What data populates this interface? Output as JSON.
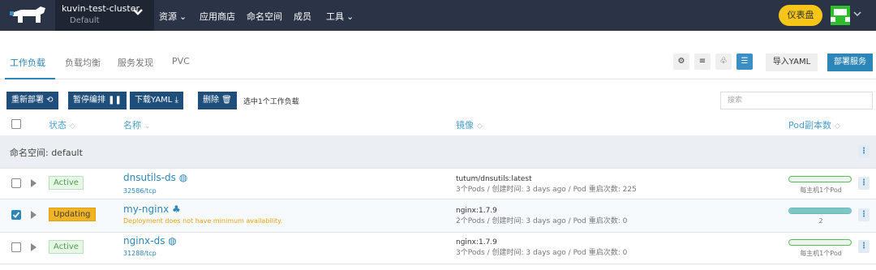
{
  "topbar": {
    "cluster_name": "kuvin-test-cluster",
    "project": "Default",
    "nav": [
      "资源",
      "应用商店",
      "命名空间",
      "成员",
      "工具"
    ],
    "dashboard_button": "仪表盘"
  },
  "tabs": [
    "工作负载",
    "负载均衡",
    "服务发现",
    "PVC"
  ],
  "header_actions": {
    "import": "导入YAML",
    "deploy": "部署服务"
  },
  "bulk_actions": {
    "redeploy": "重新部署 ⟲",
    "pause": "暂停编排 ❚❚",
    "download": "下载YAML ⤓",
    "delete": "删除 🗑",
    "selected_text": "选中1个工作负载"
  },
  "search": {
    "placeholder": "搜索"
  },
  "table": {
    "headers": {
      "state": "状态",
      "name": "名称",
      "image": "镜像",
      "pods": "Pod副本数"
    },
    "namespace_label": "命名空间: default",
    "rows": [
      {
        "checked": false,
        "state": "Active",
        "name": "dnsutils-ds",
        "sub": "32586/tcp",
        "image": "tutum/dnsutils:latest",
        "image_meta": "3个Pods / 创建时间: 3 days ago / Pod 重启次数: 225",
        "pod_label": "每主机1个Pod",
        "pod_fill": 0
      },
      {
        "checked": true,
        "state": "Updating",
        "name": "my-nginx",
        "sub": "Deployment does not have minimum availability.",
        "image": "nginx:1.7.9",
        "image_meta": "2个Pods / 创建时间: 3 days ago / Pod 重启次数: 0",
        "pod_label": "2",
        "pod_fill": 1
      },
      {
        "checked": false,
        "state": "Active",
        "name": "nginx-ds",
        "sub": "31288/tcp",
        "image": "nginx:1.7.9",
        "image_meta": "3个Pods / 创建时间: 3 days ago / Pod 重启次数: 0",
        "pod_label": "每主机1个Pod",
        "pod_fill": 0
      }
    ]
  },
  "colors": {
    "primary": "#2d86b8",
    "topbar": "#2b3346",
    "active_badge": "#e8f6e8",
    "updating_badge": "#f0b323"
  }
}
